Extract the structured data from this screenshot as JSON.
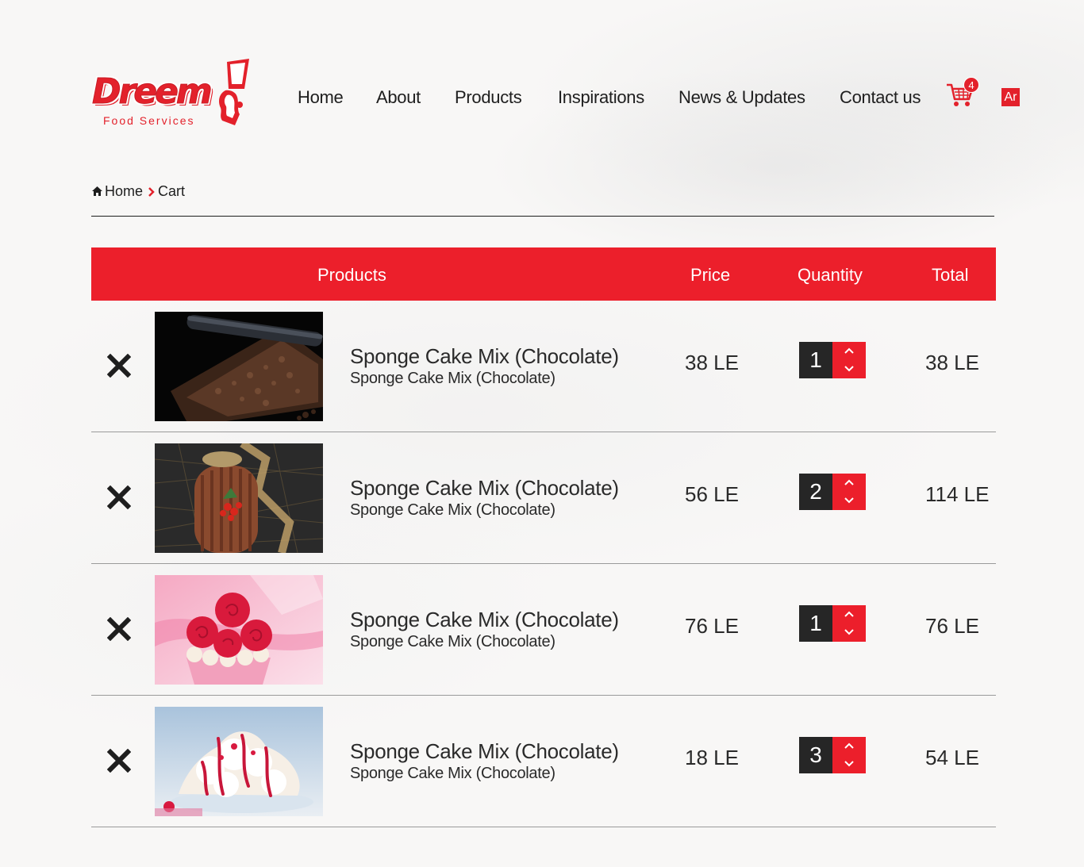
{
  "brand": {
    "name": "Dreem",
    "tagline": "Food Services",
    "accent_color": "#ec1f2b"
  },
  "nav": {
    "items": [
      {
        "label": "Home"
      },
      {
        "label": "About"
      },
      {
        "label": "Products"
      },
      {
        "label": "Inspirations"
      },
      {
        "label": "News & Updates"
      },
      {
        "label": "Contact us"
      }
    ],
    "cart_count": "4",
    "cart_icon": "shopping-cart-icon",
    "language_toggle": "Ar"
  },
  "breadcrumb": {
    "home_icon": "home-icon",
    "home": "Home",
    "separator_icon": "chevron-right-icon",
    "current": "Cart"
  },
  "cart_table": {
    "headers": {
      "products": "Products",
      "price": "Price",
      "quantity": "Quantity",
      "total": "Total"
    },
    "rows": [
      {
        "name": "Sponge Cake Mix (Chocolate)",
        "subtitle": "Sponge Cake Mix (Chocolate)",
        "price": "38 LE",
        "quantity": "1",
        "total": "38 LE",
        "image": "chocolate-mat-photo"
      },
      {
        "name": "Sponge Cake Mix (Chocolate)",
        "subtitle": "Sponge Cake Mix (Chocolate)",
        "price": "56 LE",
        "quantity": "2",
        "total": "114 LE",
        "image": "chocolate-log-cake-photo"
      },
      {
        "name": "Sponge Cake Mix (Chocolate)",
        "subtitle": "Sponge Cake Mix (Chocolate)",
        "price": "76 LE",
        "quantity": "1",
        "total": "76 LE",
        "image": "rose-cupcake-photo"
      },
      {
        "name": "Sponge Cake Mix (Chocolate)",
        "subtitle": "Sponge Cake Mix (Chocolate)",
        "price": "18 LE",
        "quantity": "3",
        "total": "54 LE",
        "image": "meringue-dessert-photo"
      }
    ]
  }
}
